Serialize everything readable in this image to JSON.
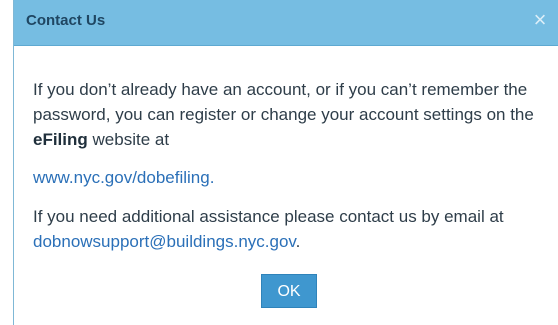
{
  "dialog": {
    "title": "Contact Us",
    "close_symbol": "×",
    "paragraph1_prefix": "If you don’t already have an account, or if you can’t remember the password, you can register or change your account settings on the ",
    "paragraph1_bold": "eFiling",
    "paragraph1_suffix": " website at",
    "website_link": "www.nyc.gov/dobefiling.",
    "paragraph2_prefix": "If you need additional assistance please contact us by email at ",
    "email_link": "dobnowsupport@buildings.nyc.gov",
    "paragraph2_suffix": ".",
    "ok_label": "OK"
  },
  "colors": {
    "titlebar": "#76bde2",
    "title_text": "#1f4662",
    "body_text": "#2e3d49",
    "link": "#2b70b8",
    "button": "#3f97cf",
    "button_text": "#ffffff"
  },
  "icons": {
    "close": "close-icon"
  }
}
